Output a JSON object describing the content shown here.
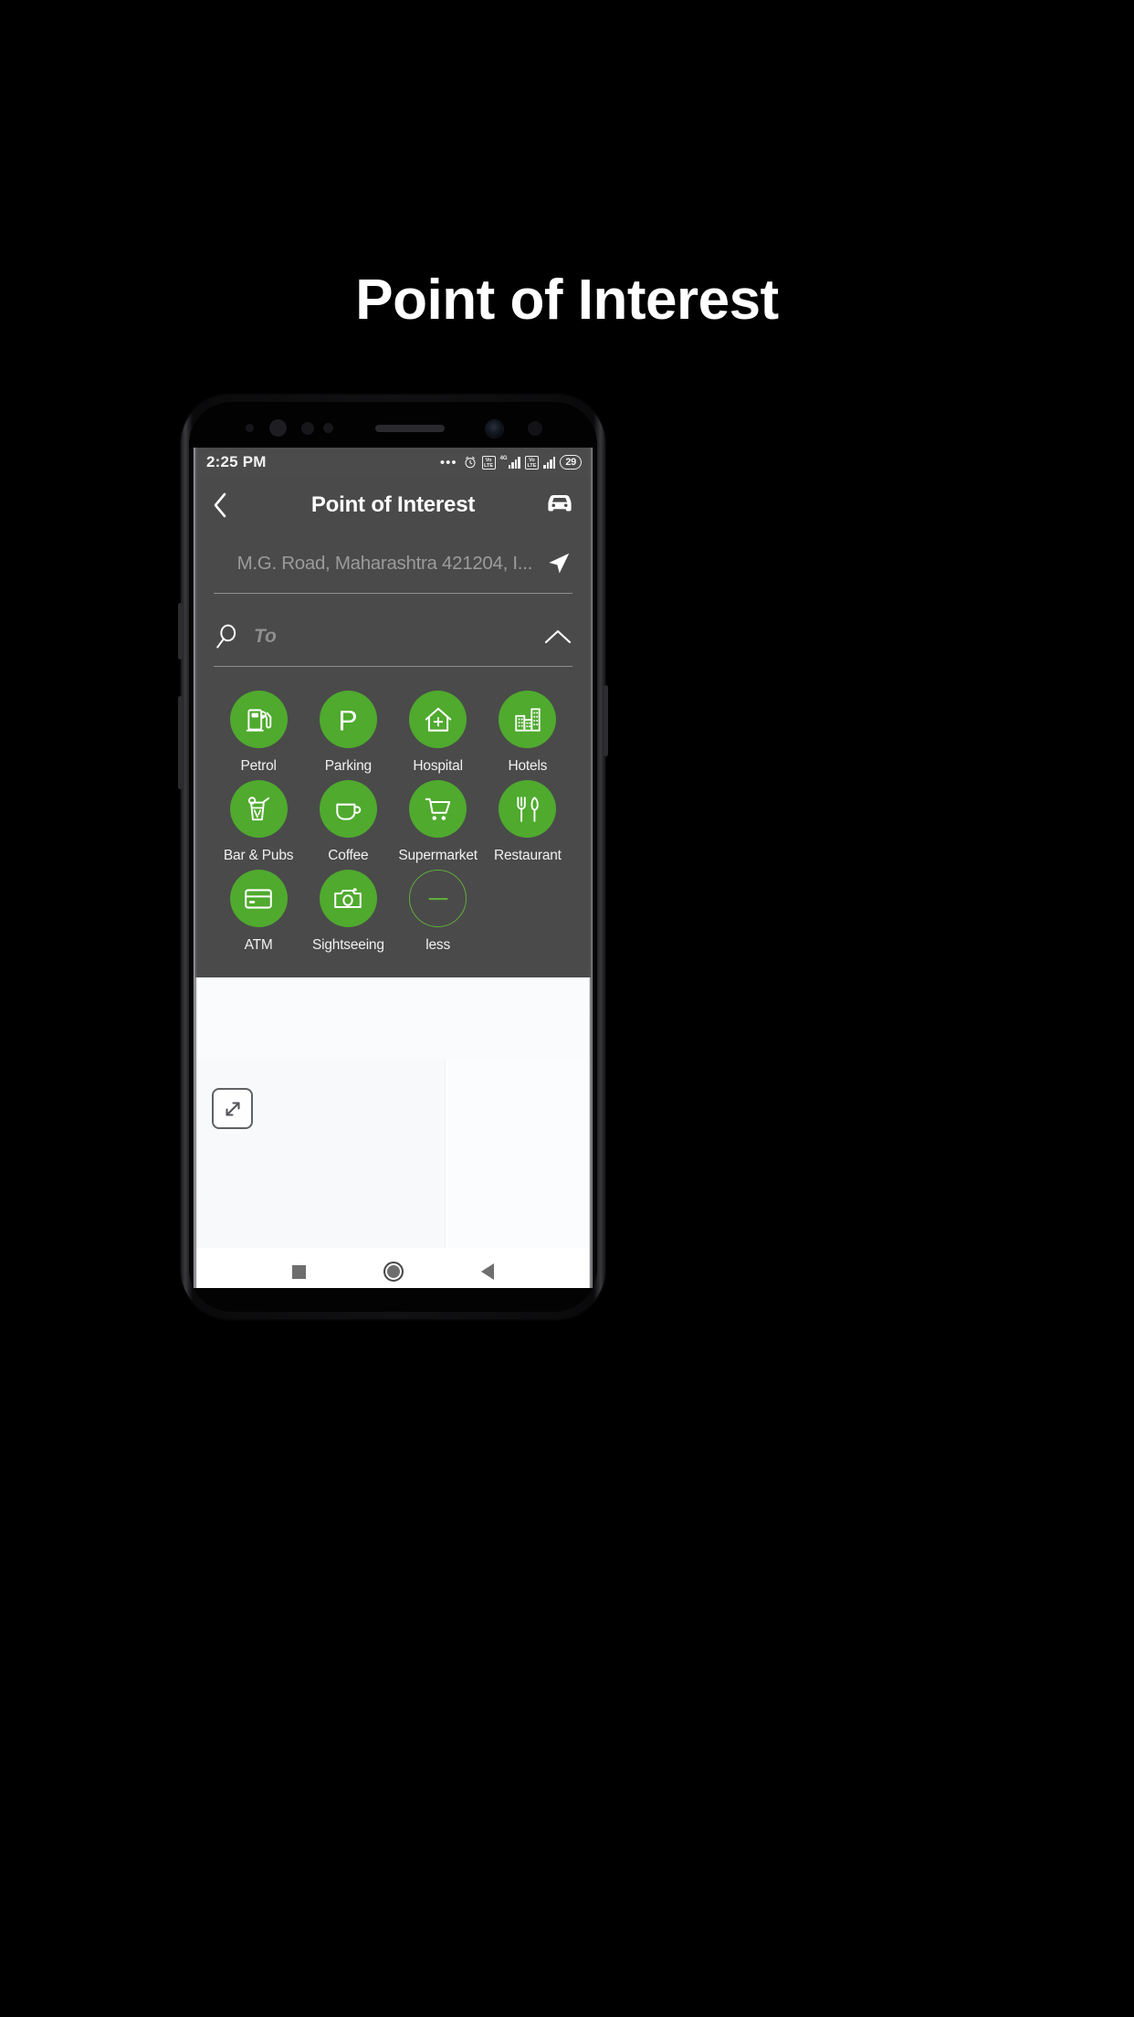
{
  "page": {
    "title": "Point of Interest",
    "background": "#000000"
  },
  "device": {
    "accent_green": "#4faa2e",
    "sheet_bg": "#4a4a4a",
    "statusbar_bg": "#4b4b4b"
  },
  "statusbar": {
    "time": "2:25 PM",
    "overflow_dots": "•••",
    "alarm_icon": "alarm-clock-icon",
    "volte1": "VoLTE",
    "volte1_top": "Vo",
    "volte1_bottom": "LTE",
    "network_type": "4G",
    "volte2_top": "Vo",
    "volte2_bottom": "LTE",
    "battery_percent": "29"
  },
  "appbar": {
    "back_icon": "chevron-left-icon",
    "title": "Point of Interest",
    "car_icon": "car-icon"
  },
  "search": {
    "from_value": "M.G. Road, Maharashtra 421204, I...",
    "from_icon": "navigation-arrow-icon",
    "to_placeholder": "To",
    "to_value": "",
    "to_icon": "magnifier-icon",
    "collapse_icon": "chevron-up-icon"
  },
  "poi": {
    "items": [
      {
        "label": "Petrol",
        "icon": "fuel-pump-icon",
        "style": "filled"
      },
      {
        "label": "Parking",
        "icon": "parking-p-icon",
        "style": "filled"
      },
      {
        "label": "Hospital",
        "icon": "hospital-icon",
        "style": "filled"
      },
      {
        "label": "Hotels",
        "icon": "buildings-icon",
        "style": "filled"
      },
      {
        "label": "Bar & Pubs",
        "icon": "cocktail-icon",
        "style": "filled"
      },
      {
        "label": "Coffee",
        "icon": "coffee-cup-icon",
        "style": "filled"
      },
      {
        "label": "Supermarket",
        "icon": "shopping-cart-icon",
        "style": "filled"
      },
      {
        "label": "Restaurant",
        "icon": "cutlery-icon",
        "style": "filled"
      },
      {
        "label": "ATM",
        "icon": "credit-card-icon",
        "style": "filled"
      },
      {
        "label": "Sightseeing",
        "icon": "camera-icon",
        "style": "filled"
      },
      {
        "label": "less",
        "icon": "minus-icon",
        "style": "outline"
      }
    ]
  },
  "map": {
    "expand_icon": "expand-arrows-icon"
  },
  "navbar": {
    "recents": "recents-square-icon",
    "home": "home-circle-icon",
    "back": "back-triangle-icon"
  }
}
